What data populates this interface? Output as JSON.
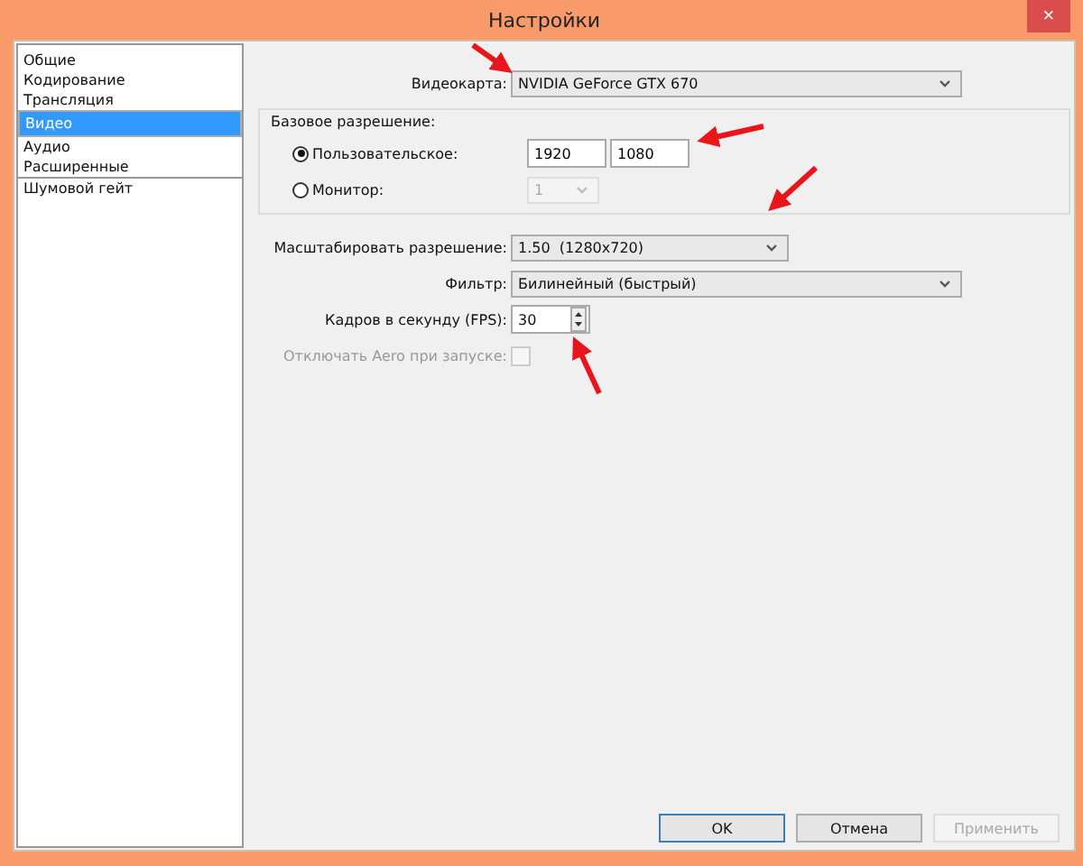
{
  "window": {
    "title": "Настройки",
    "close": "×"
  },
  "sidebar": {
    "items": [
      {
        "label": "Общие",
        "selected": false,
        "divider_above": false
      },
      {
        "label": "Кодирование",
        "selected": false,
        "divider_above": false
      },
      {
        "label": "Трансляция",
        "selected": false,
        "divider_above": false
      },
      {
        "label": "Видео",
        "selected": true,
        "divider_above": false
      },
      {
        "label": "Аудио",
        "selected": false,
        "divider_above": false
      },
      {
        "label": "Расширенные",
        "selected": false,
        "divider_above": false
      },
      {
        "label": "Шумовой гейт",
        "selected": false,
        "divider_above": true
      }
    ]
  },
  "video_card": {
    "label": "Видеокарта:",
    "value": "NVIDIA GeForce GTX 670"
  },
  "base_resolution": {
    "title": "Базовое разрешение:",
    "options": [
      {
        "label": "Пользовательское:",
        "selected": true,
        "kind": "fields",
        "values": [
          "1920",
          "1080"
        ]
      },
      {
        "label": "Монитор:",
        "selected": false,
        "kind": "select",
        "value": "1",
        "disabled": true
      }
    ]
  },
  "scale": {
    "label": "Масштабировать разрешение:",
    "value": "1.50  (1280x720)"
  },
  "filter": {
    "label": "Фильтр:",
    "value": "Билинейный (быстрый)"
  },
  "fps": {
    "label": "Кадров в секунду (FPS):",
    "value": "30"
  },
  "aero": {
    "label": "Отключать Aero при запуске:",
    "checked": false,
    "disabled": true
  },
  "buttons": [
    {
      "label": "OK",
      "disabled": false,
      "default": true
    },
    {
      "label": "Отмена",
      "disabled": false,
      "default": false
    },
    {
      "label": "Применить",
      "disabled": true,
      "default": false
    }
  ]
}
